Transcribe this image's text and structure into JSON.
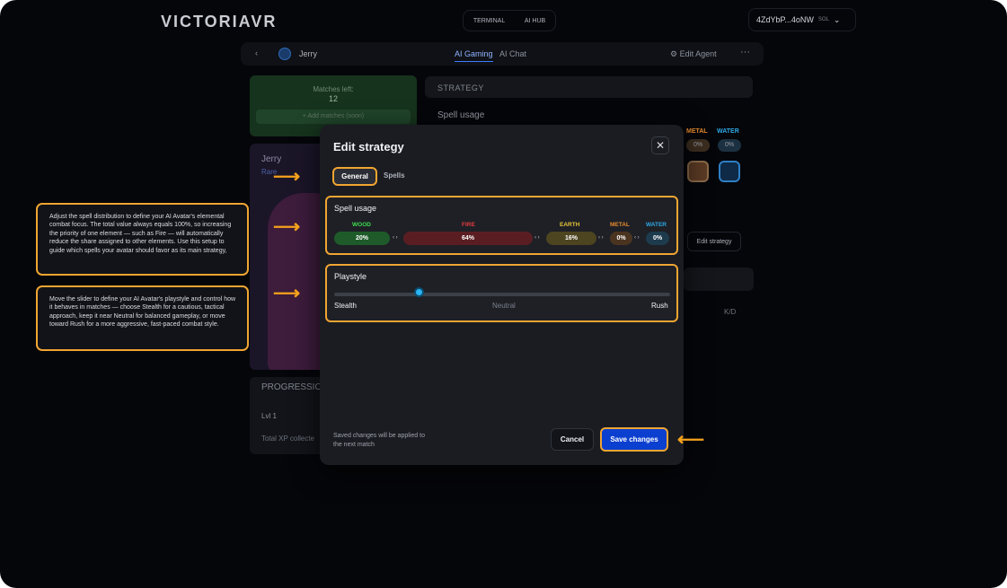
{
  "brand": {
    "logo": "VICTORIAVR"
  },
  "topnav": {
    "items": [
      "TERMINAL",
      "AI HUB"
    ]
  },
  "wallet": {
    "address": "4ZdYbP...4oNW",
    "chain": "SOL",
    "chevron": "⌄"
  },
  "agentbar": {
    "back": "‹",
    "name": "Jerry",
    "tabs": [
      "AI Gaming",
      "AI Chat"
    ],
    "edit": "Edit Agent",
    "more": "···",
    "edit_icon": "⚙"
  },
  "leftcard": {
    "matches_label": "Matches left:",
    "matches_value": "12",
    "add_label": "Add matches (soon)",
    "add_icon": "+"
  },
  "hero": {
    "name": "Jerry",
    "rarity": "Rare"
  },
  "progression": {
    "title": "PROGRESSION",
    "level": "Lvl 1",
    "xp": "Total XP collecte"
  },
  "strategy": {
    "title": "STRATEGY",
    "spell_usage": "Spell usage",
    "mini_elements": [
      {
        "label": "METAL",
        "value": "0%",
        "color": "#e58a2e"
      },
      {
        "label": "WATER",
        "value": "0%",
        "color": "#2ea9e6"
      }
    ],
    "edit_button": "Edit strategy",
    "kd": "K/D"
  },
  "modal": {
    "title": "Edit strategy",
    "close": "✕",
    "tabs": [
      "General",
      "Spells"
    ],
    "spell_usage": {
      "title": "Spell usage",
      "elements": [
        {
          "label": "WOOD",
          "value": "20%",
          "color": "#3ddc4f",
          "bg": "#1f5b2a"
        },
        {
          "label": "FIRE",
          "value": "64%",
          "color": "#e53b3b",
          "bg": "#5a1e22"
        },
        {
          "label": "EARTH",
          "value": "16%",
          "color": "#e8c53a",
          "bg": "#4d4420"
        },
        {
          "label": "METAL",
          "value": "0%",
          "color": "#e58a2e",
          "bg": "#4a3420"
        },
        {
          "label": "WATER",
          "value": "0%",
          "color": "#2ea9e6",
          "bg": "#1d3b4d"
        }
      ],
      "arrow": "‹ ›"
    },
    "playstyle": {
      "title": "Playstyle",
      "labels": [
        "Stealth",
        "Neutral",
        "Rush"
      ],
      "position": 0.25
    },
    "saved_note": "Saved changes will be applied to the next match",
    "cancel": "Cancel",
    "save": "Save changes"
  },
  "notes": [
    "Adjust the spell distribution to define your AI Avatar's elemental combat focus. The total value always equals 100%, so increasing the priority of one element — such as Fire — will automatically reduce the share assigned to other elements. Use this setup to guide which spells your avatar should favor as its main strategy,",
    "Move the slider to define your AI Avatar's playstyle and control how it behaves in matches — choose Stealth for a cautious, tactical approach, keep it near Neutral for balanced gameplay, or move toward Rush for a more aggressive, fast-paced combat style."
  ],
  "arrow_glyph": "⟶",
  "arrow_left_glyph": "⟵",
  "accent": "#f0a532"
}
